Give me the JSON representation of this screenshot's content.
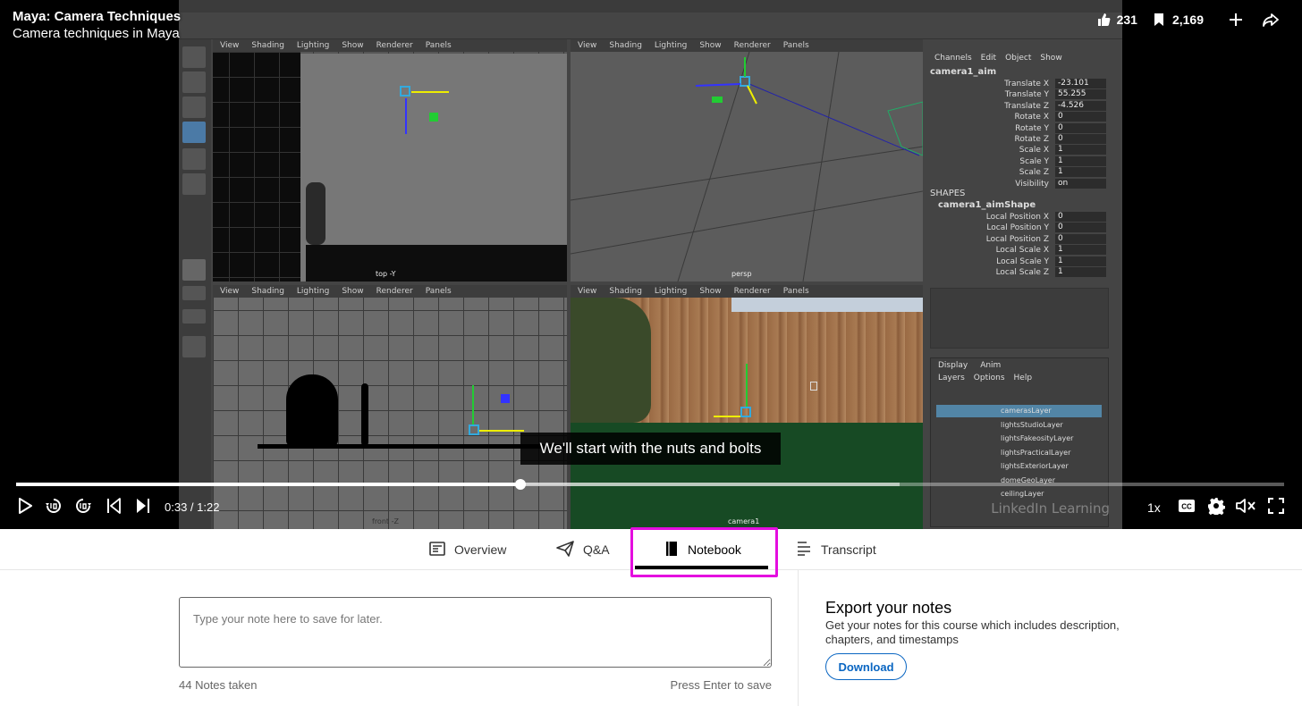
{
  "video": {
    "course_title": "Maya: Camera Techniques",
    "video_title": "Camera techniques in Maya",
    "likes": "231",
    "saves": "2,169",
    "caption": "We'll start with the nuts and bolts",
    "time": "0:33 / 1:22",
    "progress": {
      "played": 0.398,
      "buffered": 0.697
    },
    "speed": "1x",
    "icons": {
      "like": "thumbs-up-icon",
      "save": "bookmark-icon",
      "add": "plus-icon",
      "share": "share-arrow-icon",
      "play": "play-icon",
      "rewind": "rewind-10-icon",
      "forward": "forward-10-icon",
      "prev": "skip-previous-icon",
      "next": "skip-next-icon",
      "cc": "closed-captions-icon",
      "settings": "gear-icon",
      "mute": "volume-muted-icon",
      "fullscreen": "fullscreen-icon"
    }
  },
  "maya": {
    "viewport_menu": [
      "View",
      "Shading",
      "Lighting",
      "Show",
      "Renderer",
      "Panels"
    ],
    "viewport_labels": [
      "top -Y",
      "persp",
      "front -Z",
      "camera1"
    ],
    "channel_menu": [
      "Channels",
      "Edit",
      "Object",
      "Show"
    ],
    "object_name": "camera1_aim",
    "channels": [
      {
        "name": "Translate X",
        "value": "-23.101"
      },
      {
        "name": "Translate Y",
        "value": "55.255"
      },
      {
        "name": "Translate Z",
        "value": "-4.526"
      },
      {
        "name": "Rotate X",
        "value": "0"
      },
      {
        "name": "Rotate Y",
        "value": "0"
      },
      {
        "name": "Rotate Z",
        "value": "0"
      },
      {
        "name": "Scale X",
        "value": "1"
      },
      {
        "name": "Scale Y",
        "value": "1"
      },
      {
        "name": "Scale Z",
        "value": "1"
      },
      {
        "name": "Visibility",
        "value": "on"
      }
    ],
    "shapes_label": "SHAPES",
    "shape_name": "camera1_aimShape",
    "shape_channels": [
      {
        "name": "Local Position X",
        "value": "0"
      },
      {
        "name": "Local Position Y",
        "value": "0"
      },
      {
        "name": "Local Position Z",
        "value": "0"
      },
      {
        "name": "Local Scale X",
        "value": "1"
      },
      {
        "name": "Local Scale Y",
        "value": "1"
      },
      {
        "name": "Local Scale Z",
        "value": "1"
      }
    ],
    "layer_tabs": [
      "Display",
      "Anim"
    ],
    "layer_menu": [
      "Layers",
      "Options",
      "Help"
    ],
    "layers": [
      "camerasLayer",
      "lightsStudioLayer",
      "lightsFakeosityLayer",
      "lightsPracticalLayer",
      "lightsExteriorLayer",
      "domeGeoLayer",
      "ceilingLayer"
    ],
    "watermark": "LinkedIn Learning"
  },
  "tabs": [
    {
      "label": "Overview",
      "icon": "overview-icon"
    },
    {
      "label": "Q&A",
      "icon": "paper-plane-icon"
    },
    {
      "label": "Notebook",
      "icon": "notebook-icon",
      "active": true
    },
    {
      "label": "Transcript",
      "icon": "transcript-lines-icon"
    }
  ],
  "notebook": {
    "placeholder": "Type your note here to save for later.",
    "notes_taken": "44 Notes taken",
    "press_enter": "Press Enter to save"
  },
  "export": {
    "title": "Export your notes",
    "description": "Get your notes for this course which includes description, chapters, and timestamps",
    "button": "Download"
  },
  "colors": {
    "accent": "#0a66c2",
    "tab_highlight": "#e40ddf",
    "video_bg": "#000000"
  }
}
